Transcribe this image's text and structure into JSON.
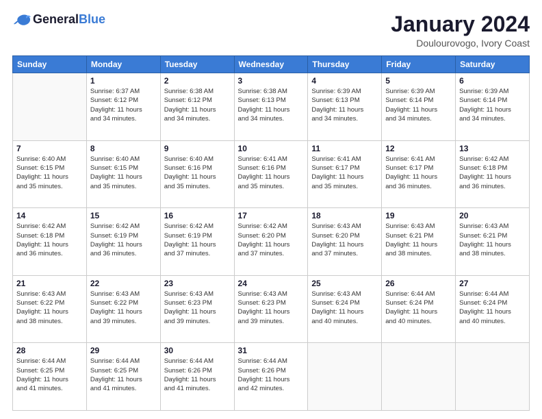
{
  "header": {
    "logo_general": "General",
    "logo_blue": "Blue",
    "month_title": "January 2024",
    "subtitle": "Doulourovogo, Ivory Coast"
  },
  "days_of_week": [
    "Sunday",
    "Monday",
    "Tuesday",
    "Wednesday",
    "Thursday",
    "Friday",
    "Saturday"
  ],
  "weeks": [
    [
      {
        "num": "",
        "info": ""
      },
      {
        "num": "1",
        "info": "Sunrise: 6:37 AM\nSunset: 6:12 PM\nDaylight: 11 hours\nand 34 minutes."
      },
      {
        "num": "2",
        "info": "Sunrise: 6:38 AM\nSunset: 6:12 PM\nDaylight: 11 hours\nand 34 minutes."
      },
      {
        "num": "3",
        "info": "Sunrise: 6:38 AM\nSunset: 6:13 PM\nDaylight: 11 hours\nand 34 minutes."
      },
      {
        "num": "4",
        "info": "Sunrise: 6:39 AM\nSunset: 6:13 PM\nDaylight: 11 hours\nand 34 minutes."
      },
      {
        "num": "5",
        "info": "Sunrise: 6:39 AM\nSunset: 6:14 PM\nDaylight: 11 hours\nand 34 minutes."
      },
      {
        "num": "6",
        "info": "Sunrise: 6:39 AM\nSunset: 6:14 PM\nDaylight: 11 hours\nand 34 minutes."
      }
    ],
    [
      {
        "num": "7",
        "info": "Sunrise: 6:40 AM\nSunset: 6:15 PM\nDaylight: 11 hours\nand 35 minutes."
      },
      {
        "num": "8",
        "info": "Sunrise: 6:40 AM\nSunset: 6:15 PM\nDaylight: 11 hours\nand 35 minutes."
      },
      {
        "num": "9",
        "info": "Sunrise: 6:40 AM\nSunset: 6:16 PM\nDaylight: 11 hours\nand 35 minutes."
      },
      {
        "num": "10",
        "info": "Sunrise: 6:41 AM\nSunset: 6:16 PM\nDaylight: 11 hours\nand 35 minutes."
      },
      {
        "num": "11",
        "info": "Sunrise: 6:41 AM\nSunset: 6:17 PM\nDaylight: 11 hours\nand 35 minutes."
      },
      {
        "num": "12",
        "info": "Sunrise: 6:41 AM\nSunset: 6:17 PM\nDaylight: 11 hours\nand 36 minutes."
      },
      {
        "num": "13",
        "info": "Sunrise: 6:42 AM\nSunset: 6:18 PM\nDaylight: 11 hours\nand 36 minutes."
      }
    ],
    [
      {
        "num": "14",
        "info": "Sunrise: 6:42 AM\nSunset: 6:18 PM\nDaylight: 11 hours\nand 36 minutes."
      },
      {
        "num": "15",
        "info": "Sunrise: 6:42 AM\nSunset: 6:19 PM\nDaylight: 11 hours\nand 36 minutes."
      },
      {
        "num": "16",
        "info": "Sunrise: 6:42 AM\nSunset: 6:19 PM\nDaylight: 11 hours\nand 37 minutes."
      },
      {
        "num": "17",
        "info": "Sunrise: 6:42 AM\nSunset: 6:20 PM\nDaylight: 11 hours\nand 37 minutes."
      },
      {
        "num": "18",
        "info": "Sunrise: 6:43 AM\nSunset: 6:20 PM\nDaylight: 11 hours\nand 37 minutes."
      },
      {
        "num": "19",
        "info": "Sunrise: 6:43 AM\nSunset: 6:21 PM\nDaylight: 11 hours\nand 38 minutes."
      },
      {
        "num": "20",
        "info": "Sunrise: 6:43 AM\nSunset: 6:21 PM\nDaylight: 11 hours\nand 38 minutes."
      }
    ],
    [
      {
        "num": "21",
        "info": "Sunrise: 6:43 AM\nSunset: 6:22 PM\nDaylight: 11 hours\nand 38 minutes."
      },
      {
        "num": "22",
        "info": "Sunrise: 6:43 AM\nSunset: 6:22 PM\nDaylight: 11 hours\nand 39 minutes."
      },
      {
        "num": "23",
        "info": "Sunrise: 6:43 AM\nSunset: 6:23 PM\nDaylight: 11 hours\nand 39 minutes."
      },
      {
        "num": "24",
        "info": "Sunrise: 6:43 AM\nSunset: 6:23 PM\nDaylight: 11 hours\nand 39 minutes."
      },
      {
        "num": "25",
        "info": "Sunrise: 6:43 AM\nSunset: 6:24 PM\nDaylight: 11 hours\nand 40 minutes."
      },
      {
        "num": "26",
        "info": "Sunrise: 6:44 AM\nSunset: 6:24 PM\nDaylight: 11 hours\nand 40 minutes."
      },
      {
        "num": "27",
        "info": "Sunrise: 6:44 AM\nSunset: 6:24 PM\nDaylight: 11 hours\nand 40 minutes."
      }
    ],
    [
      {
        "num": "28",
        "info": "Sunrise: 6:44 AM\nSunset: 6:25 PM\nDaylight: 11 hours\nand 41 minutes."
      },
      {
        "num": "29",
        "info": "Sunrise: 6:44 AM\nSunset: 6:25 PM\nDaylight: 11 hours\nand 41 minutes."
      },
      {
        "num": "30",
        "info": "Sunrise: 6:44 AM\nSunset: 6:26 PM\nDaylight: 11 hours\nand 41 minutes."
      },
      {
        "num": "31",
        "info": "Sunrise: 6:44 AM\nSunset: 6:26 PM\nDaylight: 11 hours\nand 42 minutes."
      },
      {
        "num": "",
        "info": ""
      },
      {
        "num": "",
        "info": ""
      },
      {
        "num": "",
        "info": ""
      }
    ]
  ]
}
